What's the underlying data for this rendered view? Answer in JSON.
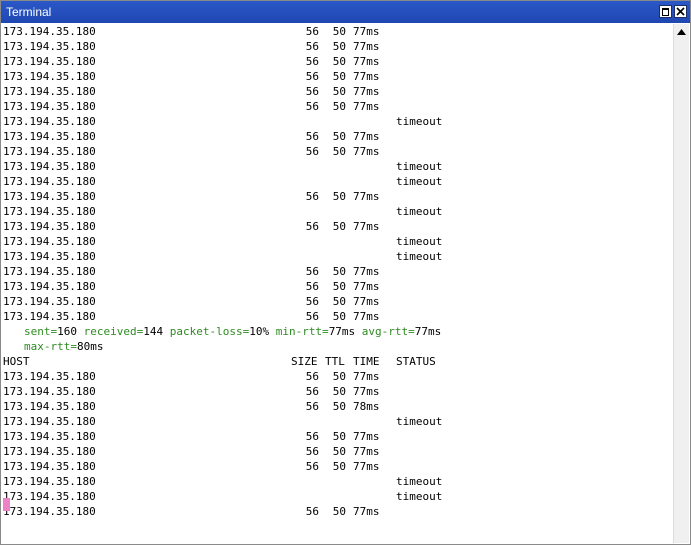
{
  "window": {
    "title": "Terminal"
  },
  "terminal": {
    "lines": [
      {
        "kind": "row",
        "host": "173.194.35.180",
        "size": "56",
        "ttl": "50",
        "time": "77ms",
        "status": ""
      },
      {
        "kind": "row",
        "host": "173.194.35.180",
        "size": "56",
        "ttl": "50",
        "time": "77ms",
        "status": ""
      },
      {
        "kind": "row",
        "host": "173.194.35.180",
        "size": "56",
        "ttl": "50",
        "time": "77ms",
        "status": ""
      },
      {
        "kind": "row",
        "host": "173.194.35.180",
        "size": "56",
        "ttl": "50",
        "time": "77ms",
        "status": ""
      },
      {
        "kind": "row",
        "host": "173.194.35.180",
        "size": "56",
        "ttl": "50",
        "time": "77ms",
        "status": ""
      },
      {
        "kind": "row",
        "host": "173.194.35.180",
        "size": "56",
        "ttl": "50",
        "time": "77ms",
        "status": ""
      },
      {
        "kind": "row",
        "host": "173.194.35.180",
        "size": "",
        "ttl": "",
        "time": "",
        "status": "timeout"
      },
      {
        "kind": "row",
        "host": "173.194.35.180",
        "size": "56",
        "ttl": "50",
        "time": "77ms",
        "status": ""
      },
      {
        "kind": "row",
        "host": "173.194.35.180",
        "size": "56",
        "ttl": "50",
        "time": "77ms",
        "status": ""
      },
      {
        "kind": "row",
        "host": "173.194.35.180",
        "size": "",
        "ttl": "",
        "time": "",
        "status": "timeout"
      },
      {
        "kind": "row",
        "host": "173.194.35.180",
        "size": "",
        "ttl": "",
        "time": "",
        "status": "timeout"
      },
      {
        "kind": "row",
        "host": "173.194.35.180",
        "size": "56",
        "ttl": "50",
        "time": "77ms",
        "status": ""
      },
      {
        "kind": "row",
        "host": "173.194.35.180",
        "size": "",
        "ttl": "",
        "time": "",
        "status": "timeout"
      },
      {
        "kind": "row",
        "host": "173.194.35.180",
        "size": "56",
        "ttl": "50",
        "time": "77ms",
        "status": ""
      },
      {
        "kind": "row",
        "host": "173.194.35.180",
        "size": "",
        "ttl": "",
        "time": "",
        "status": "timeout"
      },
      {
        "kind": "row",
        "host": "173.194.35.180",
        "size": "",
        "ttl": "",
        "time": "",
        "status": "timeout"
      },
      {
        "kind": "row",
        "host": "173.194.35.180",
        "size": "56",
        "ttl": "50",
        "time": "77ms",
        "status": ""
      },
      {
        "kind": "row",
        "host": "173.194.35.180",
        "size": "56",
        "ttl": "50",
        "time": "77ms",
        "status": ""
      },
      {
        "kind": "row",
        "host": "173.194.35.180",
        "size": "56",
        "ttl": "50",
        "time": "77ms",
        "status": ""
      },
      {
        "kind": "row",
        "host": "173.194.35.180",
        "size": "56",
        "ttl": "50",
        "time": "77ms",
        "status": ""
      },
      {
        "kind": "summary",
        "parts": [
          {
            "key": "sent=",
            "value": "160"
          },
          {
            "key": " received=",
            "value": "144"
          },
          {
            "key": " packet-loss=",
            "value": "10%"
          },
          {
            "key": " min-rtt=",
            "value": "77ms"
          },
          {
            "key": " avg-rtt=",
            "value": "77ms"
          }
        ]
      },
      {
        "kind": "summary",
        "parts": [
          {
            "key": "max-rtt=",
            "value": "80ms"
          }
        ]
      },
      {
        "kind": "header",
        "host": "HOST",
        "size": "SIZE",
        "ttl": "TTL",
        "time": "TIME",
        "status": "STATUS"
      },
      {
        "kind": "row",
        "host": "173.194.35.180",
        "size": "56",
        "ttl": "50",
        "time": "77ms",
        "status": ""
      },
      {
        "kind": "row",
        "host": "173.194.35.180",
        "size": "56",
        "ttl": "50",
        "time": "77ms",
        "status": ""
      },
      {
        "kind": "row",
        "host": "173.194.35.180",
        "size": "56",
        "ttl": "50",
        "time": "78ms",
        "status": ""
      },
      {
        "kind": "row",
        "host": "173.194.35.180",
        "size": "",
        "ttl": "",
        "time": "",
        "status": "timeout"
      },
      {
        "kind": "row",
        "host": "173.194.35.180",
        "size": "56",
        "ttl": "50",
        "time": "77ms",
        "status": ""
      },
      {
        "kind": "row",
        "host": "173.194.35.180",
        "size": "56",
        "ttl": "50",
        "time": "77ms",
        "status": ""
      },
      {
        "kind": "row",
        "host": "173.194.35.180",
        "size": "56",
        "ttl": "50",
        "time": "77ms",
        "status": ""
      },
      {
        "kind": "row",
        "host": "173.194.35.180",
        "size": "",
        "ttl": "",
        "time": "",
        "status": "timeout"
      },
      {
        "kind": "row",
        "host": "173.194.35.180",
        "size": "",
        "ttl": "",
        "time": "",
        "status": "timeout"
      },
      {
        "kind": "row",
        "host": "173.194.35.180",
        "size": "56",
        "ttl": "50",
        "time": "77ms",
        "status": ""
      }
    ]
  },
  "colors": {
    "titlebar": "#1f47b2",
    "summary_key": "#2e8b22",
    "cursor": "#ee82c8"
  },
  "icons": {
    "maximize": "maximize-icon",
    "close": "close-icon",
    "scroll_up": "chevron-up-icon"
  }
}
